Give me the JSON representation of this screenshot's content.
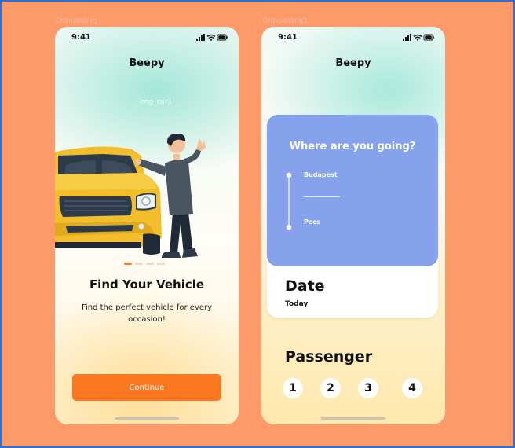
{
  "frames": [
    {
      "label": "Onboarding",
      "status_time": "9:41",
      "app_title": "Beepy",
      "image_label": "img_car1",
      "headline": "Find Your Vehicle",
      "subtext": "Find the perfect vehicle for every occasion!",
      "cta_label": "Continue",
      "pager": {
        "total": 4,
        "active": 1
      }
    },
    {
      "label": "Onboarding1",
      "status_time": "9:41",
      "app_title": "Beepy",
      "destination": {
        "title": "Where are you going?",
        "from": "Budapest",
        "to": "Pecs"
      },
      "date": {
        "title": "Date",
        "value": "Today"
      },
      "passenger": {
        "title": "Passenger",
        "options": [
          "1",
          "2",
          "3",
          "4"
        ]
      }
    }
  ],
  "colors": {
    "canvas": "#fd9a6a",
    "accent_orange": "#fb7821",
    "card_blue": "#86a2ec",
    "car_yellow": "#f2be2c"
  }
}
